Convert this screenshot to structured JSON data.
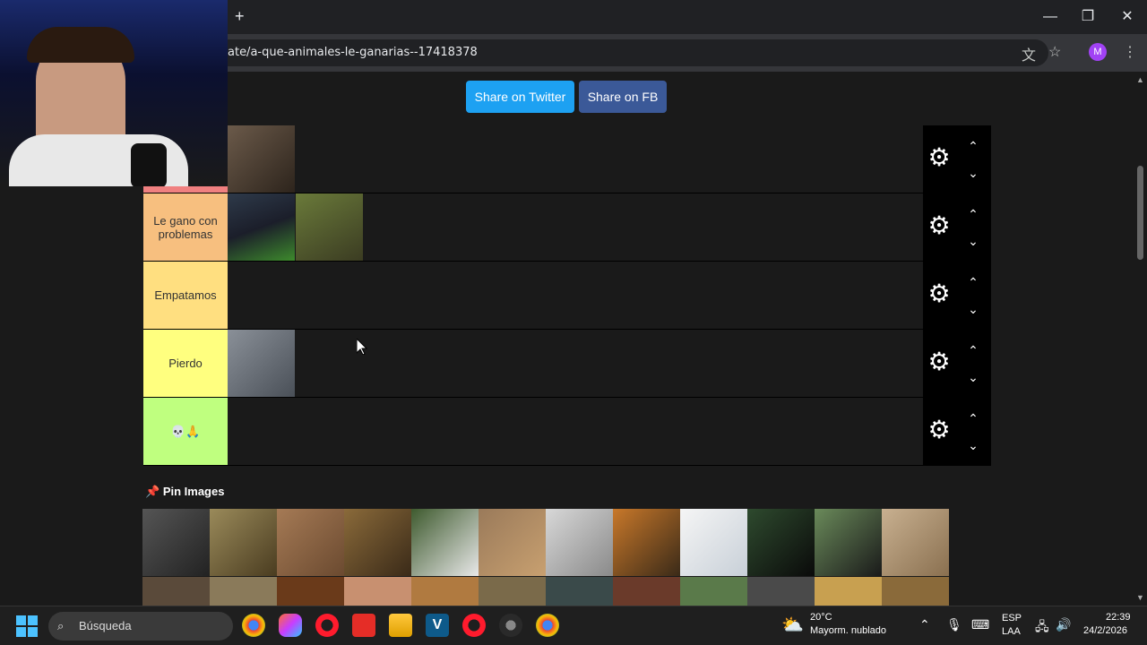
{
  "browser": {
    "url": "ate/a-que-animales-le-ganarias--17418378",
    "new_tab": "+",
    "profile_initial": "M"
  },
  "page": {
    "share_twitter": "Share on Twitter",
    "share_fb": "Share on FB",
    "tiers": [
      {
        "label": "",
        "color": "#f08080"
      },
      {
        "label": "Le gano con problemas",
        "color": "#f7bf7f"
      },
      {
        "label": "Empatamos",
        "color": "#ffdf80"
      },
      {
        "label": "Pierdo",
        "color": "#ffff7f"
      },
      {
        "label": "💀🙏",
        "color": "#bfff7f"
      }
    ],
    "pin_title": "Pin Images"
  },
  "taskbar": {
    "search": "Búsqueda",
    "weather_temp": "20°C",
    "weather_desc": "Mayorm. nublado",
    "lang1": "ESP",
    "lang2": "LAA",
    "time": "22:39",
    "date": "24/2/2026"
  }
}
